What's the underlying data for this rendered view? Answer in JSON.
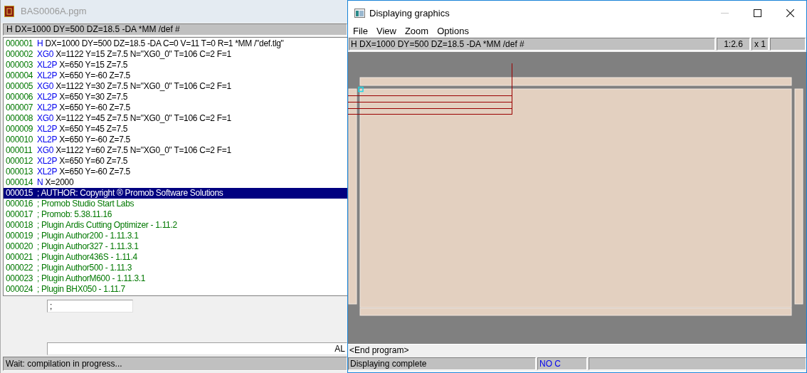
{
  "editor_window": {
    "title": "BAS0006A.pgm",
    "header": "H DX=1000 DY=500 DZ=18.5 -DA *MM /def #",
    "rows": [
      {
        "number": "000001",
        "kind": "command",
        "keyword": "H",
        "text": "DX=1000 DY=500 DZ=18.5 -DA C=0 V=11 T=0 R=1 *MM /\"def.tlg\"",
        "selected": false
      },
      {
        "number": "000002",
        "kind": "command",
        "keyword": "XG0",
        "text": "X=1122 Y=15 Z=7.5 N=\"XG0_0\" T=106 C=2 F=1",
        "selected": false
      },
      {
        "number": "000003",
        "kind": "command",
        "keyword": "XL2P",
        "text": "X=650 Y=15 Z=7.5",
        "selected": false
      },
      {
        "number": "000004",
        "kind": "command",
        "keyword": "XL2P",
        "text": "X=650 Y=-60 Z=7.5",
        "selected": false
      },
      {
        "number": "000005",
        "kind": "command",
        "keyword": "XG0",
        "text": "X=1122 Y=30 Z=7.5 N=\"XG0_0\" T=106 C=2 F=1",
        "selected": false
      },
      {
        "number": "000006",
        "kind": "command",
        "keyword": "XL2P",
        "text": "X=650 Y=30 Z=7.5",
        "selected": false
      },
      {
        "number": "000007",
        "kind": "command",
        "keyword": "XL2P",
        "text": "X=650 Y=-60 Z=7.5",
        "selected": false
      },
      {
        "number": "000008",
        "kind": "command",
        "keyword": "XG0",
        "text": "X=1122 Y=45 Z=7.5 N=\"XG0_0\" T=106 C=2 F=1",
        "selected": false
      },
      {
        "number": "000009",
        "kind": "command",
        "keyword": "XL2P",
        "text": "X=650 Y=45 Z=7.5",
        "selected": false
      },
      {
        "number": "000010",
        "kind": "command",
        "keyword": "XL2P",
        "text": "X=650 Y=-60 Z=7.5",
        "selected": false
      },
      {
        "number": "000011",
        "kind": "command",
        "keyword": "XG0",
        "text": "X=1122 Y=60 Z=7.5 N=\"XG0_0\" T=106 C=2 F=1",
        "selected": false
      },
      {
        "number": "000012",
        "kind": "command",
        "keyword": "XL2P",
        "text": "X=650 Y=60 Z=7.5",
        "selected": false
      },
      {
        "number": "000013",
        "kind": "command",
        "keyword": "XL2P",
        "text": "X=650 Y=-60 Z=7.5",
        "selected": false
      },
      {
        "number": "000014",
        "kind": "command",
        "keyword": "N",
        "text": "X=2000",
        "selected": false
      },
      {
        "number": "000015",
        "kind": "comment",
        "text": "; AUTHOR: Copyright ® Promob Software Solutions",
        "selected": true
      },
      {
        "number": "000016",
        "kind": "comment",
        "text": "; Promob Studio Start Labs",
        "selected": false
      },
      {
        "number": "000017",
        "kind": "comment",
        "text": "; Promob: 5.38.11.16",
        "selected": false
      },
      {
        "number": "000018",
        "kind": "comment",
        "text": "; Plugin Ardis Cutting Optimizer - 1.11.2",
        "selected": false
      },
      {
        "number": "000019",
        "kind": "comment",
        "text": "; Plugin Author200 - 1.11.3.1",
        "selected": false
      },
      {
        "number": "000020",
        "kind": "comment",
        "text": "; Plugin Author327 - 1.11.3.1",
        "selected": false
      },
      {
        "number": "000021",
        "kind": "comment",
        "text": "; Plugin Author436S - 1.11.4",
        "selected": false
      },
      {
        "number": "000022",
        "kind": "comment",
        "text": "; Plugin Author500 - 1.11.3",
        "selected": false
      },
      {
        "number": "000023",
        "kind": "comment",
        "text": "; Plugin AuthorM600 - 1.11.3.1",
        "selected": false
      },
      {
        "number": "000024",
        "kind": "comment",
        "text": "; Plugin BHX050 - 1.11.7",
        "selected": false
      }
    ],
    "small_field": ";",
    "long_field": "AL",
    "status_bar": "Wait: compilation in progress..."
  },
  "graphics_window": {
    "title": "Displaying graphics",
    "window_buttons": [
      {
        "kind": "minimize",
        "disabled": true
      },
      {
        "kind": "maximize",
        "disabled": false
      },
      {
        "kind": "close",
        "disabled": false
      }
    ],
    "menu": [
      "File",
      "View",
      "Zoom",
      "Options"
    ],
    "info_bar": {
      "header": "H DX=1000 DY=500 DZ=18.5 -DA *MM /def #",
      "scale": "1:2.6",
      "multiplier": "x 1"
    },
    "program_line": "<End program>",
    "status_bar": {
      "message": "Displaying complete",
      "mode": "NO C"
    }
  }
}
